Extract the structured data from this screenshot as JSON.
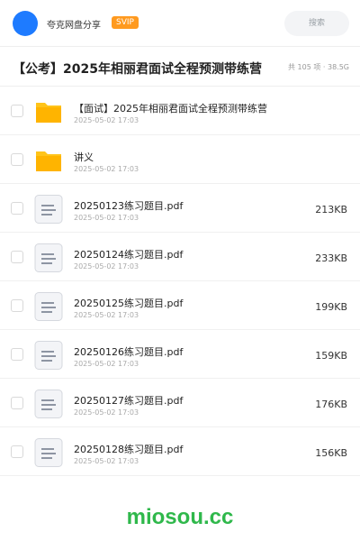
{
  "header": {
    "share_name": "夸克网盘分享",
    "badge": "SVIP",
    "search_placeholder": "搜索"
  },
  "folder": {
    "title": "【公考】2025年相丽君面试全程预测带练营",
    "meta": "共 105 项 · 38.5G"
  },
  "files": [
    {
      "type": "folder",
      "name": "【面试】2025年相丽君面试全程预测带练营",
      "date": "2025-05-02 17:03",
      "size": ""
    },
    {
      "type": "folder",
      "name": "讲义",
      "date": "2025-05-02 17:03",
      "size": ""
    },
    {
      "type": "file",
      "name": "20250123练习题目.pdf",
      "date": "2025-05-02 17:03",
      "size": "213KB"
    },
    {
      "type": "file",
      "name": "20250124练习题目.pdf",
      "date": "2025-05-02 17:03",
      "size": "233KB"
    },
    {
      "type": "file",
      "name": "20250125练习题目.pdf",
      "date": "2025-05-02 17:03",
      "size": "199KB"
    },
    {
      "type": "file",
      "name": "20250126练习题目.pdf",
      "date": "2025-05-02 17:03",
      "size": "159KB"
    },
    {
      "type": "file",
      "name": "20250127练习题目.pdf",
      "date": "2025-05-02 17:03",
      "size": "176KB"
    },
    {
      "type": "file",
      "name": "20250128练习题目.pdf",
      "date": "2025-05-02 17:03",
      "size": "156KB"
    }
  ],
  "watermark": "miosou.cc",
  "colors": {
    "avatar": "#1e7bff",
    "badge": "#ff9a1f",
    "folder": "#ffc41a",
    "watermark": "#2fb84b"
  }
}
